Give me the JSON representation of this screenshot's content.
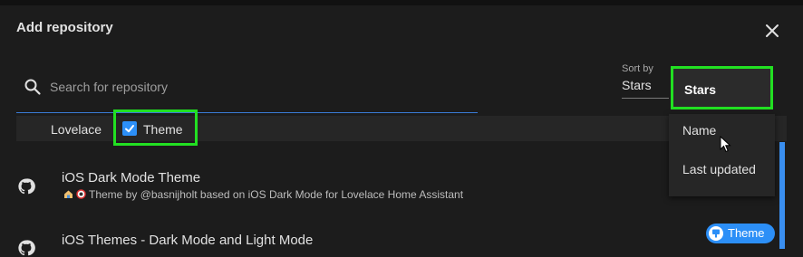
{
  "dialog": {
    "title": "Add repository",
    "close_icon": "close-icon"
  },
  "search": {
    "placeholder": "Search for repository",
    "value": "",
    "icon": "search-icon"
  },
  "sort": {
    "label": "Sort by",
    "current": "Stars",
    "selected": "Stars",
    "options": [
      "Name",
      "Last updated"
    ]
  },
  "filters": {
    "lovelace_label": "Lovelace",
    "theme_label": "Theme",
    "theme_checked": true
  },
  "repositories": [
    {
      "title": "iOS Dark Mode Theme",
      "description": "Theme by @basnijholt based on iOS Dark Mode for Lovelace Home Assistant",
      "icon": "github-icon"
    },
    {
      "title": "iOS Themes - Dark Mode and Light Mode",
      "category_badge": "Theme",
      "icon": "github-icon"
    }
  ],
  "colors": {
    "accent": "#2c8ff7",
    "highlight": "#22e022",
    "background": "#1c1c1c"
  }
}
